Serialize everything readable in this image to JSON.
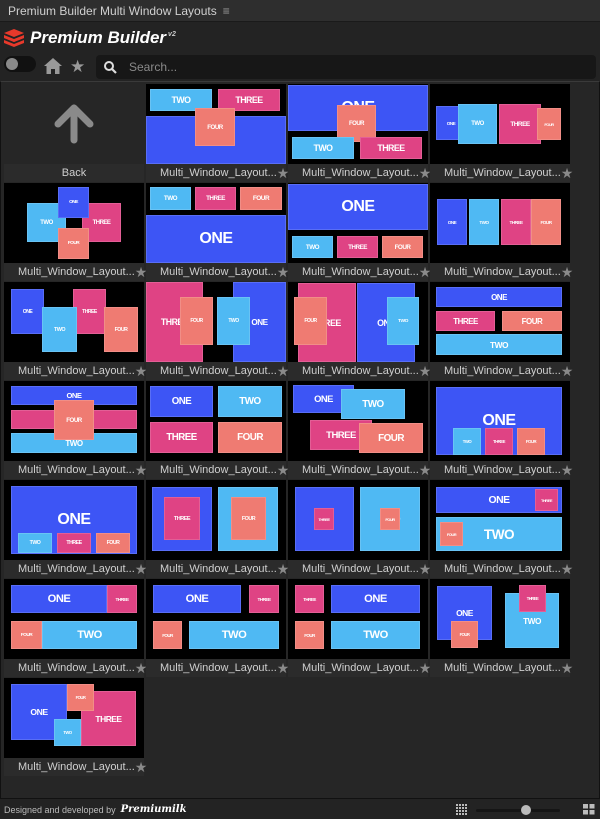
{
  "window_title": "Premium Builder Multi Window Layouts",
  "menu_icon": "hamburger-icon",
  "logo": {
    "name": "Premium Builder",
    "version": "v2",
    "icon": "layers-icon",
    "color": "#e8392b"
  },
  "toolbar": {
    "toggle_on": false,
    "home_icon": "home-icon",
    "favorites_icon": "star-icon",
    "search_placeholder": "Search...",
    "search_value": ""
  },
  "colors": {
    "ONE": "#3d55f5",
    "TWO": "#4fb9f3",
    "THREE": "#df4384",
    "FOUR": "#ef7b72"
  },
  "back": {
    "label": "Back",
    "icon": "arrow-up-icon"
  },
  "card_label": "Multi_Window_Layout...",
  "cards": [
    {
      "windows": [
        "TWO",
        "THREE",
        "ONE",
        "FOUR"
      ]
    },
    {
      "windows": [
        "ONE",
        "FOUR",
        "TWO",
        "THREE"
      ]
    },
    {
      "windows": [
        "ONE",
        "TWO",
        "THREE",
        "FOUR"
      ]
    },
    {
      "windows": [
        "TWO",
        "THREE",
        "ONE",
        "FOUR"
      ]
    },
    {
      "windows": [
        "TWO",
        "THREE",
        "FOUR",
        "ONE"
      ]
    },
    {
      "windows": [
        "ONE",
        "TWO",
        "THREE",
        "FOUR"
      ]
    },
    {
      "windows": [
        "ONE",
        "TWO",
        "THREE",
        "FOUR"
      ]
    },
    {
      "windows": [
        "ONE",
        "THREE",
        "TWO",
        "FOUR"
      ]
    },
    {
      "windows": [
        "THREE",
        "ONE",
        "FOUR",
        "TWO"
      ]
    },
    {
      "windows": [
        "THREE",
        "ONE",
        "FOUR",
        "TWO"
      ]
    },
    {
      "windows": [
        "ONE",
        "THREE",
        "FOUR",
        "TWO"
      ]
    },
    {
      "windows": [
        "ONE",
        "THREE",
        "TWO",
        "FOUR"
      ]
    },
    {
      "windows": [
        "ONE",
        "TWO",
        "THREE",
        "FOUR"
      ]
    },
    {
      "windows": [
        "ONE",
        "TWO",
        "THREE",
        "FOUR"
      ]
    },
    {
      "windows": [
        "ONE",
        "TWO",
        "THREE",
        "FOUR"
      ]
    },
    {
      "windows": [
        "ONE",
        "TWO",
        "THREE",
        "FOUR"
      ]
    },
    {
      "windows": [
        "ONE",
        "TWO",
        "THREE",
        "FOUR"
      ]
    },
    {
      "windows": [
        "ONE",
        "TWO",
        "THREE",
        "FOUR"
      ]
    },
    {
      "windows": [
        "ONE",
        "THREE",
        "TWO",
        "FOUR"
      ]
    },
    {
      "windows": [
        "ONE",
        "THREE",
        "FOUR",
        "TWO"
      ]
    },
    {
      "windows": [
        "ONE",
        "THREE",
        "FOUR",
        "TWO"
      ]
    },
    {
      "windows": [
        "THREE",
        "ONE",
        "FOUR",
        "TWO"
      ]
    },
    {
      "windows": [
        "ONE",
        "TWO",
        "THREE",
        "FOUR"
      ]
    },
    {
      "windows": [
        "ONE",
        "THREE",
        "FOUR",
        "TWO"
      ]
    }
  ],
  "footer": {
    "credit": "Designed and developed by",
    "brand": "Premiumilk",
    "thumb_size_percent": 60,
    "small_grid_icon": "grid-small-icon",
    "large_grid_icon": "grid-large-icon"
  }
}
